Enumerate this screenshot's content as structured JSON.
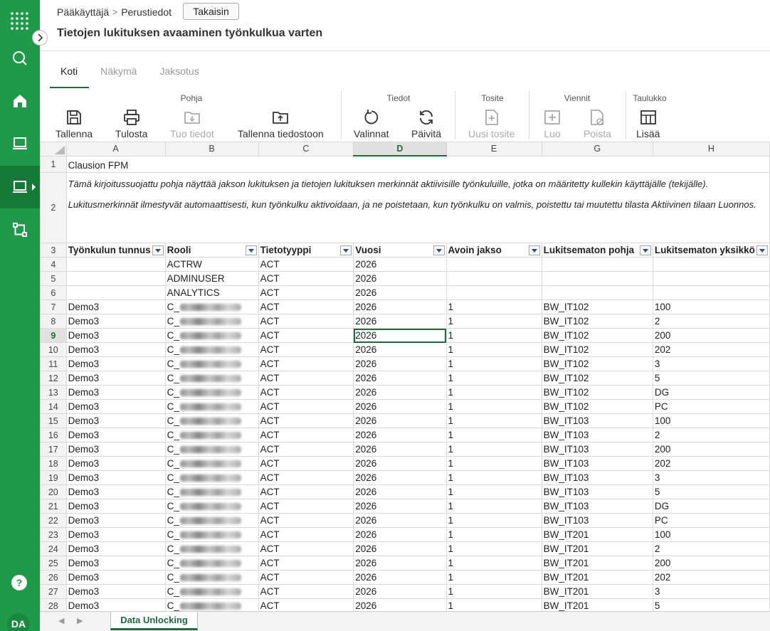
{
  "header": {
    "breadcrumb": [
      "Pääkäyttäjä",
      "Perustiedot"
    ],
    "back_label": "Takaisin",
    "title": "Tietojen lukituksen avaaminen työnkulkua varten"
  },
  "rail": {
    "avatar": "DA",
    "help": "?"
  },
  "tabs": [
    {
      "label": "Koti",
      "active": true
    },
    {
      "label": "Näkymä",
      "active": false
    },
    {
      "label": "Jaksotus",
      "active": false
    }
  ],
  "ribbon": {
    "groups": {
      "pohja": "Pohja",
      "tiedot": "Tiedot",
      "tosite": "Tosite",
      "viennit": "Viennit",
      "taulukko": "Taulukko"
    },
    "buttons": {
      "tallenna": "Tallenna",
      "tulosta": "Tulosta",
      "tuo_tiedot": "Tuo tiedot",
      "tallenna_tiedostoon": "Tallenna tiedostoon",
      "valinnat": "Valinnat",
      "paivita": "Päivitä",
      "uusi_tosite": "Uusi tosite",
      "luo": "Luo",
      "poista": "Poista",
      "lisaa": "Lisää"
    }
  },
  "sheet": {
    "columns": [
      "A",
      "B",
      "C",
      "D",
      "E",
      "G",
      "H"
    ],
    "selected_column": "D",
    "title_cell": "Clausion FPM",
    "description_1": "Tämä kirjoitussuojattu pohja näyttää jakson lukituksen ja tietojen lukituksen merkinnät aktiivisille työnkuluille, jotka on määritetty kullekin käyttäjälle (tekijälle).",
    "description_2": "Lukitusmerkinnät ilmestyvät automaattisesti, kun työnkulku aktivoidaan, ja ne poistetaan, kun työnkulku on valmis, poistettu tai muutettu tilasta Aktiivinen tilaan Luonnos.",
    "headers": [
      "Työnkulun tunnus",
      "Rooli",
      "Tietotyyppi",
      "Vuosi",
      "Avoin jakso",
      "Lukitsematon pohja",
      "Lukitsematon yksikkö"
    ],
    "selected_row": 9,
    "rows": [
      {
        "n": 4,
        "a": "",
        "b": "ACTRW",
        "c": "ACT",
        "d": "2026",
        "e": "",
        "g": "",
        "h": ""
      },
      {
        "n": 5,
        "a": "",
        "b": "ADMINUSER",
        "c": "ACT",
        "d": "2026",
        "e": "",
        "g": "",
        "h": ""
      },
      {
        "n": 6,
        "a": "",
        "b": "ANALYTICS",
        "c": "ACT",
        "d": "2026",
        "e": "",
        "g": "",
        "h": ""
      },
      {
        "n": 7,
        "a": "Demo3",
        "b": "C_",
        "c": "ACT",
        "d": "2026",
        "e": "1",
        "g": "BW_IT102",
        "h": "100"
      },
      {
        "n": 8,
        "a": "Demo3",
        "b": "C_",
        "c": "ACT",
        "d": "2026",
        "e": "1",
        "g": "BW_IT102",
        "h": "2"
      },
      {
        "n": 9,
        "a": "Demo3",
        "b": "C_",
        "c": "ACT",
        "d": "2026",
        "e": "1",
        "g": "BW_IT102",
        "h": "200"
      },
      {
        "n": 10,
        "a": "Demo3",
        "b": "C_",
        "c": "ACT",
        "d": "2026",
        "e": "1",
        "g": "BW_IT102",
        "h": "202"
      },
      {
        "n": 11,
        "a": "Demo3",
        "b": "C_",
        "c": "ACT",
        "d": "2026",
        "e": "1",
        "g": "BW_IT102",
        "h": "3"
      },
      {
        "n": 12,
        "a": "Demo3",
        "b": "C_",
        "c": "ACT",
        "d": "2026",
        "e": "1",
        "g": "BW_IT102",
        "h": "5"
      },
      {
        "n": 13,
        "a": "Demo3",
        "b": "C_",
        "c": "ACT",
        "d": "2026",
        "e": "1",
        "g": "BW_IT102",
        "h": "DG"
      },
      {
        "n": 14,
        "a": "Demo3",
        "b": "C_",
        "c": "ACT",
        "d": "2026",
        "e": "1",
        "g": "BW_IT102",
        "h": "PC"
      },
      {
        "n": 15,
        "a": "Demo3",
        "b": "C_",
        "c": "ACT",
        "d": "2026",
        "e": "1",
        "g": "BW_IT103",
        "h": "100"
      },
      {
        "n": 16,
        "a": "Demo3",
        "b": "C_",
        "c": "ACT",
        "d": "2026",
        "e": "1",
        "g": "BW_IT103",
        "h": "2"
      },
      {
        "n": 17,
        "a": "Demo3",
        "b": "C_",
        "c": "ACT",
        "d": "2026",
        "e": "1",
        "g": "BW_IT103",
        "h": "200"
      },
      {
        "n": 18,
        "a": "Demo3",
        "b": "C_",
        "c": "ACT",
        "d": "2026",
        "e": "1",
        "g": "BW_IT103",
        "h": "202"
      },
      {
        "n": 19,
        "a": "Demo3",
        "b": "C_",
        "c": "ACT",
        "d": "2026",
        "e": "1",
        "g": "BW_IT103",
        "h": "3"
      },
      {
        "n": 20,
        "a": "Demo3",
        "b": "C_",
        "c": "ACT",
        "d": "2026",
        "e": "1",
        "g": "BW_IT103",
        "h": "5"
      },
      {
        "n": 21,
        "a": "Demo3",
        "b": "C_",
        "c": "ACT",
        "d": "2026",
        "e": "1",
        "g": "BW_IT103",
        "h": "DG"
      },
      {
        "n": 22,
        "a": "Demo3",
        "b": "C_",
        "c": "ACT",
        "d": "2026",
        "e": "1",
        "g": "BW_IT103",
        "h": "PC"
      },
      {
        "n": 23,
        "a": "Demo3",
        "b": "C_",
        "c": "ACT",
        "d": "2026",
        "e": "1",
        "g": "BW_IT201",
        "h": "100"
      },
      {
        "n": 24,
        "a": "Demo3",
        "b": "C_",
        "c": "ACT",
        "d": "2026",
        "e": "1",
        "g": "BW_IT201",
        "h": "2"
      },
      {
        "n": 25,
        "a": "Demo3",
        "b": "C_",
        "c": "ACT",
        "d": "2026",
        "e": "1",
        "g": "BW_IT201",
        "h": "200"
      },
      {
        "n": 26,
        "a": "Demo3",
        "b": "C_",
        "c": "ACT",
        "d": "2026",
        "e": "1",
        "g": "BW_IT201",
        "h": "202"
      },
      {
        "n": 27,
        "a": "Demo3",
        "b": "C_",
        "c": "ACT",
        "d": "2026",
        "e": "1",
        "g": "BW_IT201",
        "h": "3"
      },
      {
        "n": 28,
        "a": "Demo3",
        "b": "C_",
        "c": "ACT",
        "d": "2026",
        "e": "1",
        "g": "BW_IT201",
        "h": "5"
      }
    ],
    "tab_name": "Data Unlocking"
  },
  "colors": {
    "accent": "#1f9a49",
    "accent_dark": "#1f6b3f"
  }
}
